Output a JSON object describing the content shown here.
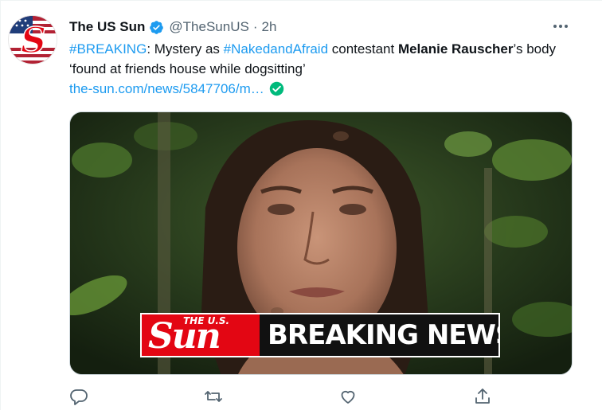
{
  "tweet": {
    "author_name": "The US Sun",
    "handle": "@TheSunUS",
    "separator": "·",
    "time": "2h",
    "text": {
      "hashtag1": "#BREAKING",
      "part1": ": Mystery as ",
      "hashtag2": "#NakedandAfraid",
      "part2": " contestant ",
      "bold_name": "Melanie Rauscher",
      "part3": "’s body ‘found at friends house while dogsitting’"
    },
    "link": "the-sun.com/news/5847706/m…"
  },
  "media": {
    "banner_logo_small": "THE U.S.",
    "banner_logo_big": "Sun",
    "banner_text": "BREAKING NEWS"
  },
  "icons": {
    "avatar": "the-sun-logo-avatar",
    "verified": "verified-badge-icon",
    "more": "more-icon",
    "link_check": "check-circle-icon",
    "reply": "reply-icon",
    "retweet": "retweet-icon",
    "like": "like-icon",
    "share": "share-icon"
  },
  "colors": {
    "accent": "#1d9bf0",
    "text": "#0f1419",
    "secondary": "#536471",
    "link_check": "#00ba7c",
    "banner_red": "#e30613"
  }
}
